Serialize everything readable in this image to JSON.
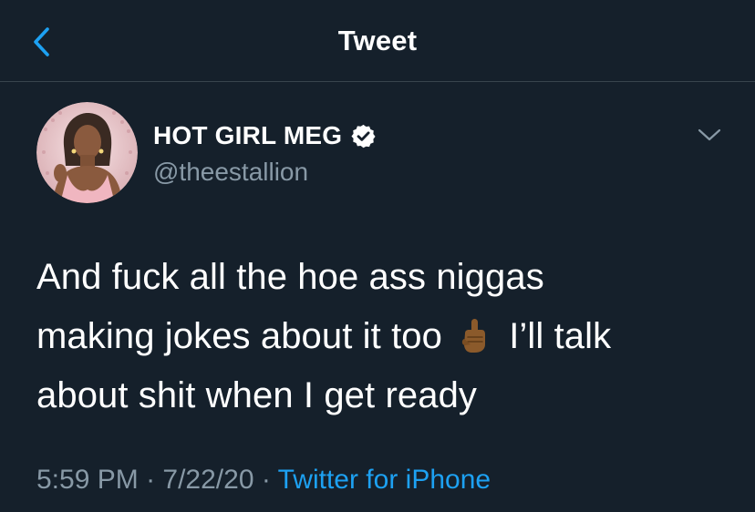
{
  "nav": {
    "title": "Tweet",
    "back_icon": "chevron-left-icon"
  },
  "colors": {
    "background": "#15202b",
    "accent": "#1da1f2",
    "secondary_text": "#8899a6",
    "divider": "#38444d"
  },
  "author": {
    "display_name": "HOT GIRL MEG",
    "handle": "@theestallion",
    "verified": true,
    "verified_icon": "verified-badge-icon",
    "avatar_icon": "profile-avatar"
  },
  "menu": {
    "icon": "chevron-down-icon"
  },
  "tweet": {
    "line1": "And fuck all the hoe ass niggas",
    "line2_before": "making jokes about it too",
    "emoji": "middle-finger-emoji",
    "line2_after": "I’ll talk",
    "line3": "about shit when I get ready"
  },
  "meta": {
    "time": "5:59 PM",
    "separator": " · ",
    "date": "7/22/20",
    "source": "Twitter for iPhone"
  }
}
